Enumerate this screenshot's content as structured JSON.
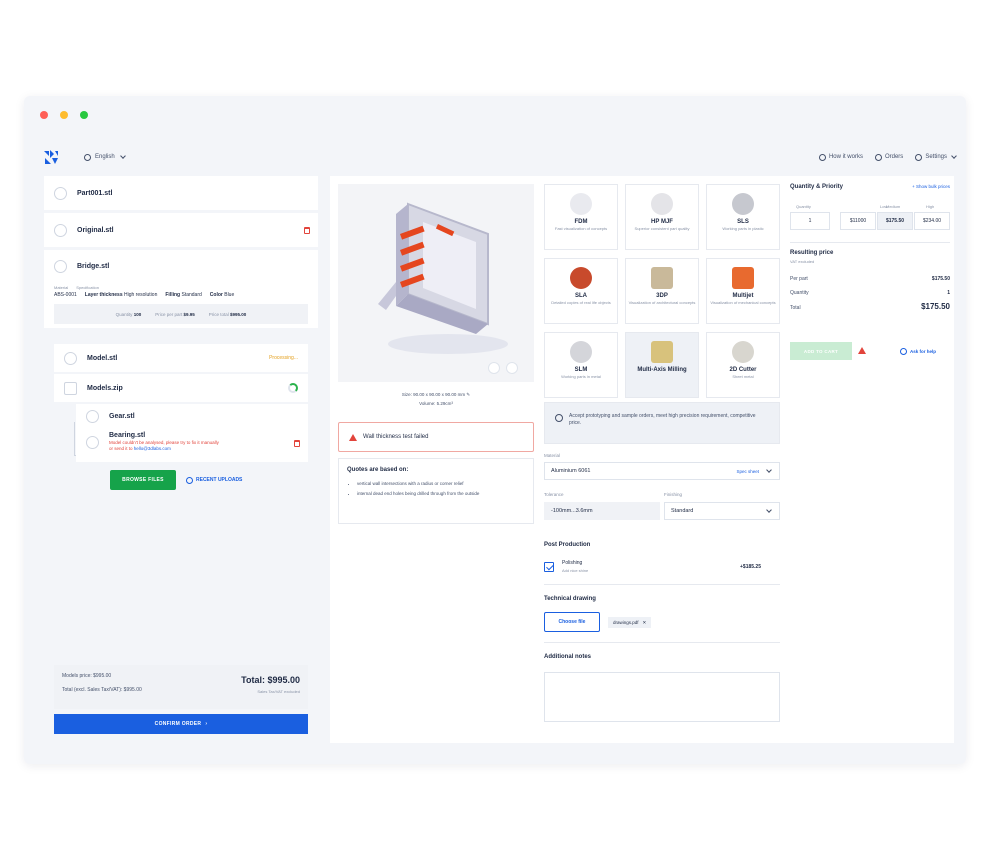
{
  "header": {
    "language": "English",
    "nav": [
      "How it works",
      "Orders",
      "Settings"
    ]
  },
  "colors": {
    "accent": "#1a5fe0",
    "success": "#16a34a",
    "error": "#e2443b",
    "warning": "#e4a01f",
    "traffic": [
      "#ff5f57",
      "#febc2e",
      "#28c840"
    ]
  },
  "files": {
    "top": [
      {
        "name": "Part001.stl"
      },
      {
        "name": "Original.stl"
      }
    ],
    "bridge": {
      "name": "Bridge.stl",
      "spec_head_material": "Material",
      "spec_head_spec": "Specification",
      "material": "ABS-0001",
      "layer_label": "Layer thickness",
      "layer_value": "High resolution",
      "filling_label": "Filling",
      "filling_value": "Standard",
      "color_label": "Color",
      "color_value": "Blue",
      "qty_label": "Quantity",
      "qty_value": "100",
      "ppp_label": "Price per part",
      "ppp_value": "$9.95",
      "pt_label": "Price total",
      "pt_value": "$995.00"
    },
    "uploads": {
      "model": "Model.stl",
      "model_status": "Processing...",
      "zip": "Models.zip",
      "gear": "Gear.stl",
      "bearing": "Bearing.stl",
      "error_line1": "Model couldn't be analysed, please try to fix it manually",
      "error_line2_pre": "or send it to",
      "error_email": "hello@3dlabs.com",
      "browse": "BROWSE FILES",
      "recent": "RECENT UPLOADS"
    },
    "totals": {
      "models_price": "Models price: $995.00",
      "total_excl": "Total (excl. Sales Tax/VAT): $995.00",
      "total": "Total: $995.00",
      "total_sub": "Sales Tax/VAT excluded"
    },
    "confirm": "CONFIRM ORDER"
  },
  "viewer": {
    "size": "Size: 90.00 x 90.00 x 90.00 mm",
    "volume": "Volume: 5.29cm³",
    "warning": "Wall thickness test failed",
    "quotes_title": "Quotes are based on:",
    "quotes": [
      "vertical wall intersections with a radius or corner relief",
      "internal dead end holes being drilled through from the outside"
    ]
  },
  "tech": {
    "cards": [
      {
        "title": "FDM",
        "desc": "Fast visualization of concepts"
      },
      {
        "title": "HP MJF",
        "desc": "Superior consistent part quality"
      },
      {
        "title": "SLS",
        "desc": "Working parts in plastic"
      },
      {
        "title": "SLA",
        "desc": "Detailed copies of real life objects"
      },
      {
        "title": "3DP",
        "desc": "Visualization of architectural concepts"
      },
      {
        "title": "Multijet",
        "desc": "Visualization of mechanical concepts"
      },
      {
        "title": "SLM",
        "desc": "Working parts in metal"
      },
      {
        "title": "Multi-Axis Milling",
        "desc": ""
      },
      {
        "title": "2D Cutter",
        "desc": "Sheet metal"
      }
    ],
    "info": "Accept prototyping and sample orders, meet high precision requirement, competitive price."
  },
  "form": {
    "material_label": "Material",
    "material_value": "Aluminium 6061",
    "spec_sheet": "Spec sheet",
    "tolerance_label": "Tolerance",
    "tolerance_value": "-100mm...3.6mm",
    "finishing_label": "Finishing",
    "finishing_value": "Standard",
    "post_title": "Post Production",
    "polishing": "Polishing",
    "polishing_sub": "Add nice shine",
    "polishing_price": "+$185.25",
    "drawing_title": "Technical drawing",
    "choose": "Choose file",
    "file": "drawings.pdf",
    "notes_title": "Additional notes"
  },
  "quantity": {
    "title": "Quantity & Priority",
    "bulk": "Show bulk prices",
    "quantity_label": "Quantity",
    "quantity_value": "1",
    "low_label": "Low",
    "medium_label": "Medium",
    "high_label": "High",
    "low_price": "$11000",
    "medium_price": "$175.50",
    "high_price": "$234.00",
    "resulting_title": "Resulting price",
    "resulting_sub": "VAT excluded",
    "per_part_label": "Per part",
    "per_part_value": "$175.50",
    "qty_label": "Quantity",
    "qty_value": "1",
    "total_label": "Total",
    "total_value": "$175.50",
    "add_to_cart": "ADD TO CART",
    "help": "Ask for help"
  }
}
